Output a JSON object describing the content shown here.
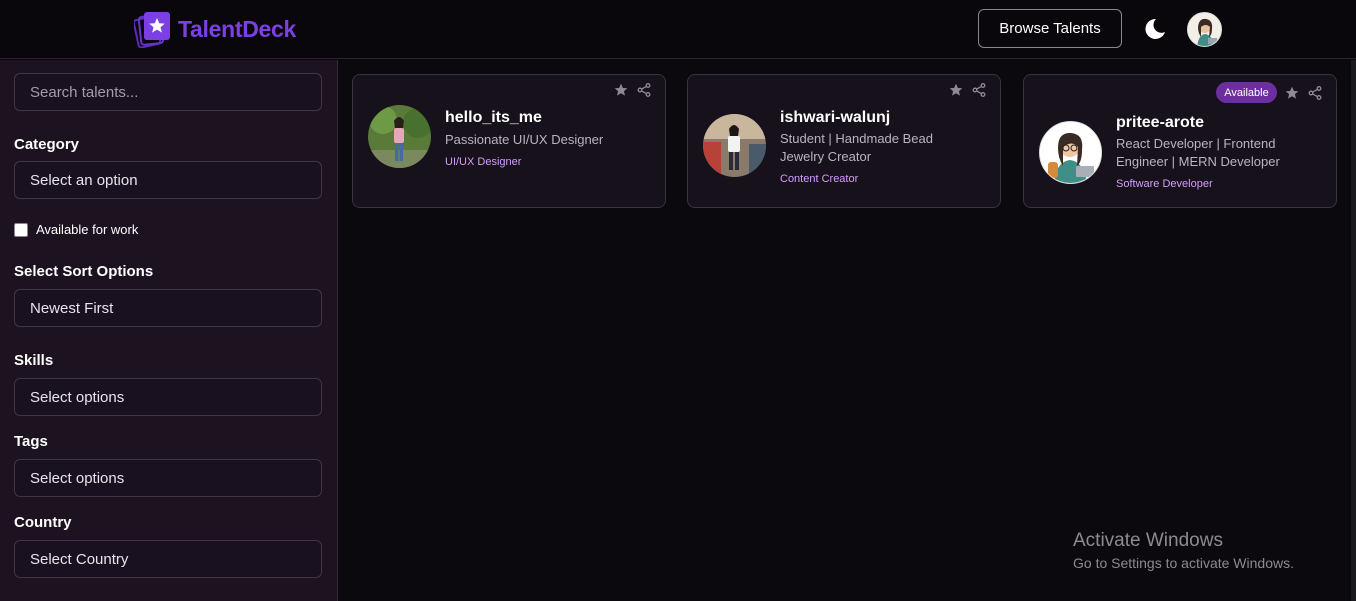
{
  "header": {
    "logo_text": "TalentDeck",
    "browse_label": "Browse Talents"
  },
  "sidebar": {
    "search_placeholder": "Search talents...",
    "category_label": "Category",
    "category_value": "Select an option",
    "available_label": "Available for work",
    "available_checked": false,
    "sort_label": "Select Sort Options",
    "sort_value": "Newest First",
    "skills_label": "Skills",
    "skills_value": "Select options",
    "tags_label": "Tags",
    "tags_value": "Select options",
    "country_label": "Country",
    "country_value": "Select Country"
  },
  "cards": [
    {
      "name": "hello_its_me",
      "bio": "Passionate UI/UX Designer",
      "category": "UI/UX Designer"
    },
    {
      "name": "ishwari-walunj",
      "bio_line1": "Student | Handmade Bead",
      "bio_line2": "Jewelry Creator",
      "category": "Content Creator"
    },
    {
      "name": "pritee-arote",
      "bio_line1": "React Developer | Frontend",
      "bio_line2": "Engineer | MERN Developer",
      "category": "Software Developer",
      "badge": "Available"
    }
  ],
  "watermark": {
    "title": "Activate Windows",
    "subtitle": "Go to Settings to activate Windows."
  },
  "colors": {
    "brand": "#7b3fe4",
    "category_text": "#d59cff",
    "badge_bg": "#6c2ea0",
    "sidebar_bg": "#1c1220",
    "card_bg": "#17111b"
  }
}
